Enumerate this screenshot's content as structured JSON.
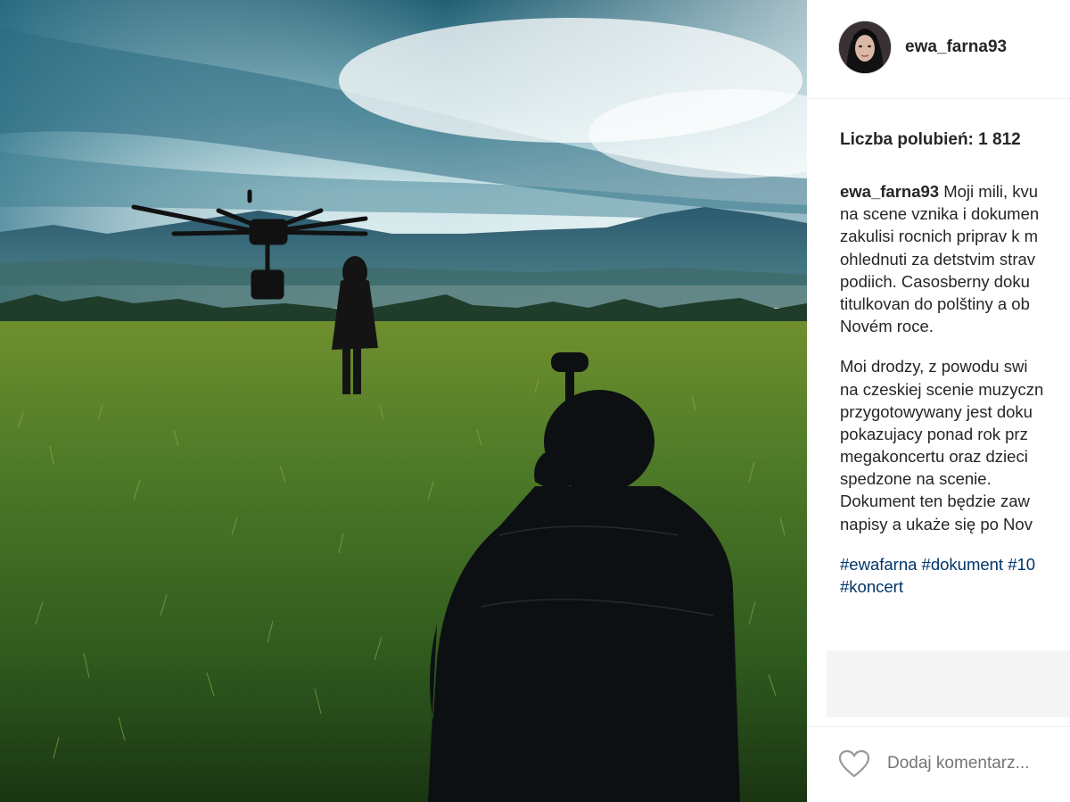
{
  "post": {
    "username": "ewa_farna93",
    "likes_label": "Liczba polubień: 1 812"
  },
  "caption": {
    "author": "ewa_farna93",
    "lines": [
      "Moji mili, kvu",
      "na scene vznika i dokumen",
      "zakulisi rocnich priprav k m",
      "ohlednuti za detstvim strav",
      "podiich. Casosberny doku",
      "titulkovan do polštiny a ob",
      "Novém roce."
    ],
    "lines2": [
      "Moi drodzy, z powodu swi",
      "na czeskiej scenie muzyczn",
      "przygotowywany jest doku",
      "pokazujacy ponad rok prz",
      "megakoncertu oraz dzieci",
      "spedzone na scenie.",
      "Dokument ten będzie zaw",
      "napisy a ukaże się po Nov"
    ],
    "hashtags_line1": "#ewafarna #dokument #10",
    "hashtags_line2": "#koncert"
  },
  "comment": {
    "placeholder": "Dodaj komentarz..."
  },
  "icons": {
    "like": "heart-icon",
    "avatar": "profile-avatar"
  },
  "colors": {
    "text": "#262626",
    "hashtag": "#003569",
    "placeholder": "#999999"
  }
}
